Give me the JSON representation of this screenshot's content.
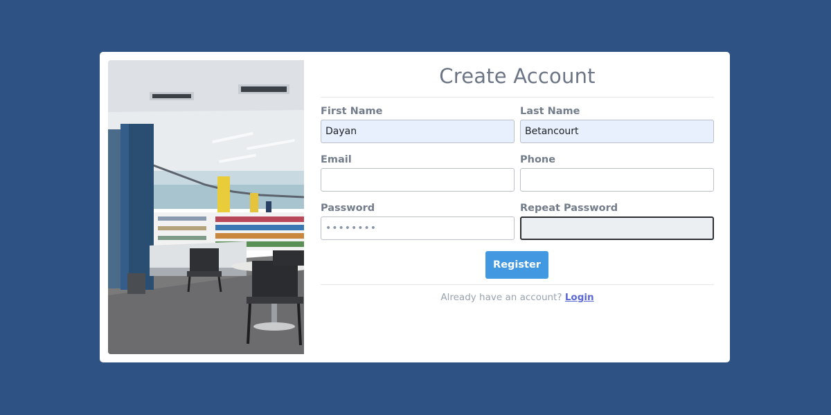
{
  "form": {
    "title": "Create Account",
    "first_name": {
      "label": "First Name",
      "value": "Dayan"
    },
    "last_name": {
      "label": "Last Name",
      "value": "Betancourt"
    },
    "email": {
      "label": "Email",
      "value": ""
    },
    "phone": {
      "label": "Phone",
      "value": ""
    },
    "password": {
      "label": "Password",
      "value": "••••••••"
    },
    "repeat_password": {
      "label": "Repeat Password",
      "value": ""
    },
    "register_label": "Register",
    "login_prompt": "Already have an account?",
    "login_link": "Login"
  },
  "colors": {
    "background": "#2e5283",
    "button": "#4299e1",
    "link": "#5a67d8",
    "autofill": "#e8f0fe"
  }
}
